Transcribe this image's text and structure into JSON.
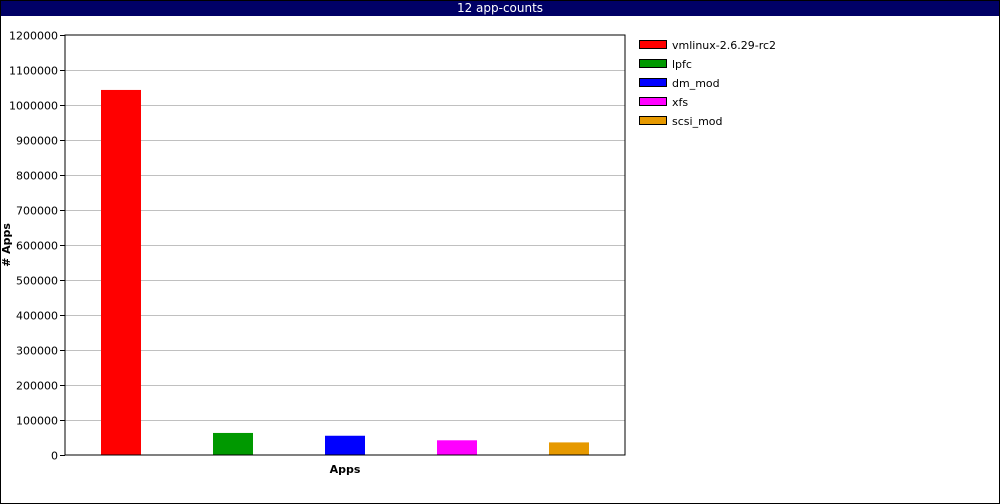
{
  "chart_data": {
    "type": "bar",
    "title": "12 app-counts",
    "xlabel": "Apps",
    "ylabel": "# Apps",
    "ylim": [
      0,
      1200000
    ],
    "yticks": [
      0,
      100000,
      200000,
      300000,
      400000,
      500000,
      600000,
      700000,
      800000,
      900000,
      1000000,
      1100000,
      1200000
    ],
    "grid": "horizontal",
    "legend_position": "right",
    "series": [
      {
        "name": "vmlinux-2.6.29-rc2",
        "value": 1043000,
        "color": "#ff0000"
      },
      {
        "name": "lpfc",
        "value": 63000,
        "color": "#009900"
      },
      {
        "name": "dm_mod",
        "value": 55000,
        "color": "#0000ff"
      },
      {
        "name": "xfs",
        "value": 42000,
        "color": "#ff00ff"
      },
      {
        "name": "scsi_mod",
        "value": 36000,
        "color": "#e69900"
      }
    ]
  }
}
